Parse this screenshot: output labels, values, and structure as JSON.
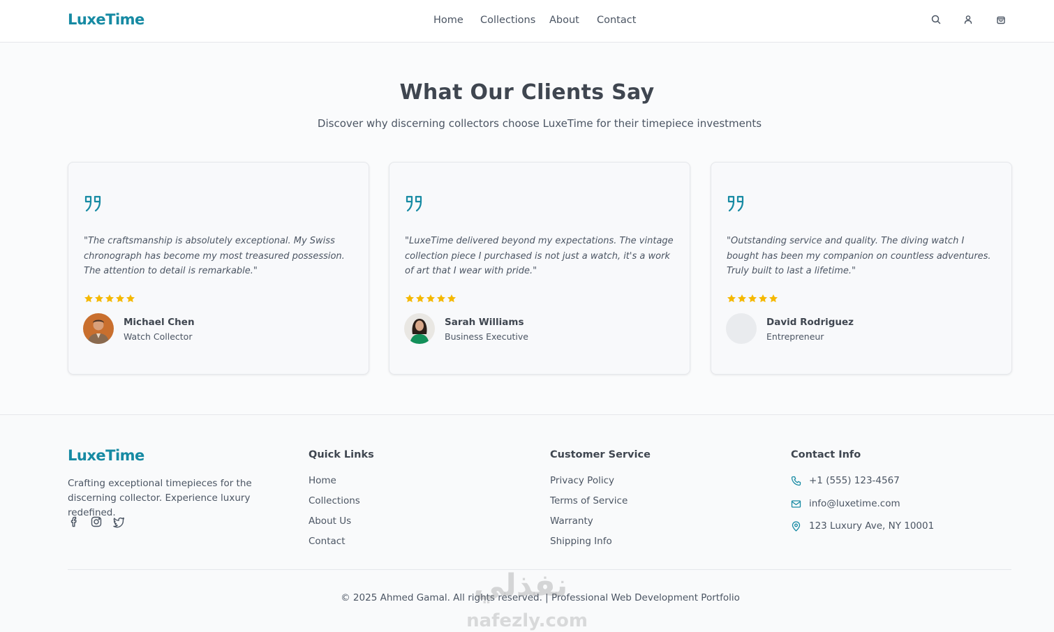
{
  "brand": {
    "name": "LuxeTime",
    "accent": "#168aa3",
    "star_color": "#f5b800"
  },
  "header": {
    "nav": [
      {
        "label": "Home"
      },
      {
        "label": "Collections"
      },
      {
        "label": "About"
      },
      {
        "label": "Contact"
      }
    ],
    "icons": [
      "search-icon",
      "user-icon",
      "shopping-bag-icon"
    ]
  },
  "testimonials": {
    "title": "What Our Clients Say",
    "subtitle": "Discover why discerning collectors choose LuxeTime for their timepiece investments",
    "items": [
      {
        "quote": "\"The craftsmanship is absolutely exceptional. My Swiss chronograph has become my most treasured possession. The attention to detail is remarkable.\"",
        "rating": 5,
        "name": "Michael Chen",
        "role": "Watch Collector"
      },
      {
        "quote": "\"LuxeTime delivered beyond my expectations. The vintage collection piece I purchased is not just a watch, it's a work of art that I wear with pride.\"",
        "rating": 5,
        "name": "Sarah Williams",
        "role": "Business Executive"
      },
      {
        "quote": "\"Outstanding service and quality. The diving watch I bought has been my companion on countless adventures. Truly built to last a lifetime.\"",
        "rating": 5,
        "name": "David Rodriguez",
        "role": "Entrepreneur"
      }
    ]
  },
  "footer": {
    "brand": "LuxeTime",
    "description": "Crafting exceptional timepieces for the discerning collector. Experience luxury redefined.",
    "social": [
      "facebook-icon",
      "instagram-icon",
      "twitter-icon"
    ],
    "quick_links": {
      "heading": "Quick Links",
      "items": [
        "Home",
        "Collections",
        "About Us",
        "Contact"
      ]
    },
    "customer_service": {
      "heading": "Customer Service",
      "items": [
        "Privacy Policy",
        "Terms of Service",
        "Warranty",
        "Shipping Info"
      ]
    },
    "contact": {
      "heading": "Contact Info",
      "phone": "+1 (555) 123-4567",
      "email": "info@luxetime.com",
      "address": "123 Luxury Ave, NY 10001"
    },
    "copyright": "© 2025 Ahmed Gamal. All rights reserved. | Professional Web Development Portfolio"
  },
  "watermark": {
    "arabic": "نفذلي",
    "latin": "nafezly.com"
  }
}
